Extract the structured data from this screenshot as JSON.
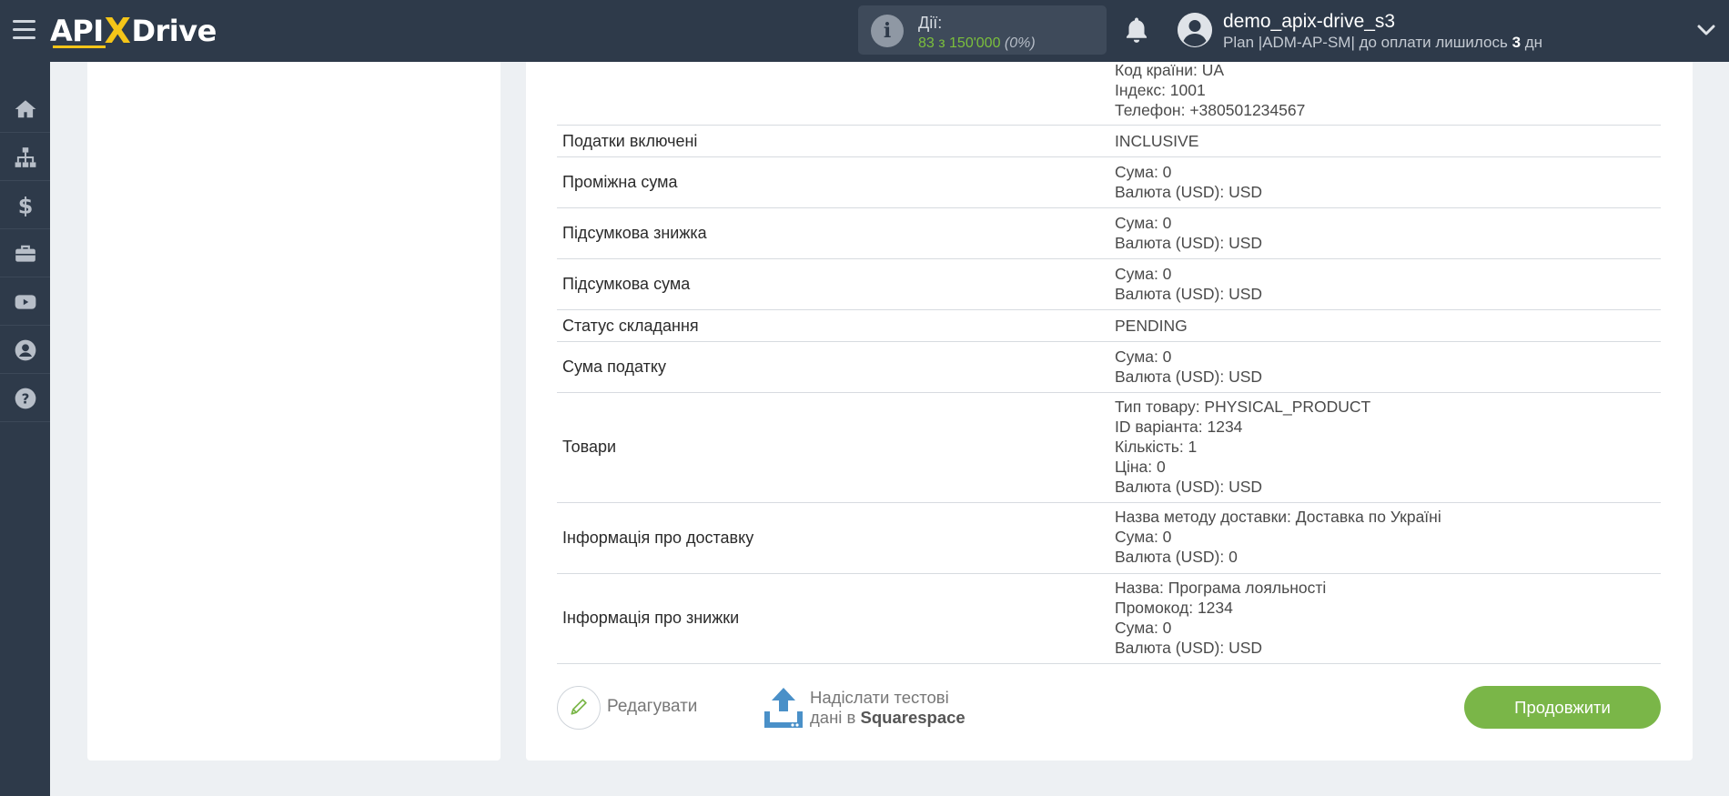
{
  "brand": {
    "logo_left": "API",
    "logo_x": "X",
    "logo_right": "Drive"
  },
  "colors": {
    "topbar": "#2e3a4a",
    "accent_green": "#7ab648",
    "logo_yellow": "#f5c518",
    "background": "#edf0f3"
  },
  "header": {
    "actions_label": "Дії:",
    "actions_count": "83 з 150'000",
    "actions_percent": "(0%)",
    "username": "demo_apix-drive_s3",
    "plan_text": "Plan |ADM-AP-SM| до оплати лишилось",
    "plan_days": "3",
    "plan_days_unit": "дн"
  },
  "sidebar": {
    "items": [
      {
        "icon": "home-icon"
      },
      {
        "icon": "sitemap-icon"
      },
      {
        "icon": "dollar-icon"
      },
      {
        "icon": "briefcase-icon"
      },
      {
        "icon": "youtube-icon"
      },
      {
        "icon": "user-circle-icon"
      },
      {
        "icon": "help-icon"
      }
    ]
  },
  "table": {
    "partial_address": [
      "Код країни: UA",
      "Індекс: 1001",
      "Телефон: +380501234567"
    ],
    "rows": [
      {
        "key": "Податки включені",
        "values": [
          "INCLUSIVE"
        ]
      },
      {
        "key": "Проміжна сума",
        "values": [
          "Сума: 0",
          "Валюта (USD): USD"
        ]
      },
      {
        "key": "Підсумкова знижка",
        "values": [
          "Сума: 0",
          "Валюта (USD): USD"
        ]
      },
      {
        "key": "Підсумкова сума",
        "values": [
          "Сума: 0",
          "Валюта (USD): USD"
        ]
      },
      {
        "key": "Статус складання",
        "values": [
          "PENDING"
        ]
      },
      {
        "key": "Сума податку",
        "values": [
          "Сума: 0",
          "Валюта (USD): USD"
        ]
      },
      {
        "key": "Товари",
        "values": [
          "Тип товару: PHYSICAL_PRODUCT",
          "ID варіанта: 1234",
          "Кількість: 1",
          "Ціна: 0",
          "Валюта (USD): USD"
        ]
      },
      {
        "key": "Інформація про доставку",
        "values": [
          "Назва методу доставки: Доставка по Україні",
          "Сума: 0",
          "Валюта (USD): 0"
        ]
      },
      {
        "key": "Інформація про знижки",
        "values": [
          "Назва: Програма лояльності",
          "Промокод: 1234",
          "Сума: 0",
          "Валюта (USD): USD"
        ]
      }
    ]
  },
  "footer": {
    "edit_label": "Редагувати",
    "send_line1": "Надіслати тестові",
    "send_line2_prefix": "дані в",
    "send_target": "Squarespace",
    "continue_label": "Продовжити"
  }
}
